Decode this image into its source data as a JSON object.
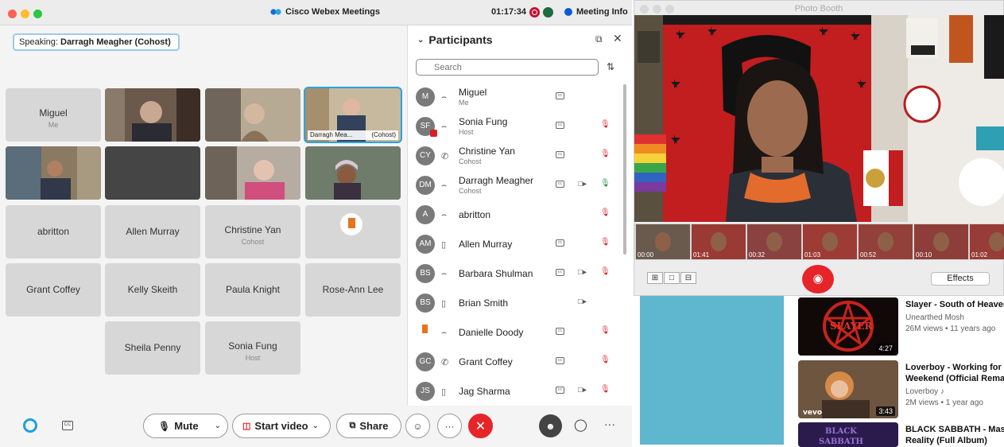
{
  "webex": {
    "app_title": "Cisco Webex Meetings",
    "clock": "01:17:34",
    "meeting_info": "Meeting Info",
    "speaking_prefix": "Speaking:",
    "speaking_name": "Darragh Meagher (Cohost)",
    "grid": [
      {
        "name": "Miguel",
        "sub": "Me",
        "kind": "name"
      },
      {
        "name": "",
        "sub": "",
        "kind": "video"
      },
      {
        "name": "",
        "sub": "",
        "kind": "video"
      },
      {
        "name": "Darragh Mea...",
        "sub": "(Cohost)",
        "kind": "video-selected"
      },
      {
        "name": "",
        "sub": "",
        "kind": "video"
      },
      {
        "name": "",
        "sub": "",
        "kind": "dark"
      },
      {
        "name": "",
        "sub": "",
        "kind": "video"
      },
      {
        "name": "",
        "sub": "",
        "kind": "video"
      },
      {
        "name": "abritton",
        "sub": "",
        "kind": "name"
      },
      {
        "name": "Allen Murray",
        "sub": "",
        "kind": "name"
      },
      {
        "name": "Christine Yan",
        "sub": "Cohost",
        "kind": "name"
      },
      {
        "name": "",
        "sub": "",
        "kind": "logo"
      },
      {
        "name": "Grant Coffey",
        "sub": "",
        "kind": "name"
      },
      {
        "name": "Kelly Skeith",
        "sub": "",
        "kind": "name"
      },
      {
        "name": "Paula Knight",
        "sub": "",
        "kind": "name"
      },
      {
        "name": "Rose-Ann Lee",
        "sub": "",
        "kind": "name"
      },
      {
        "name": "Sheila Penny",
        "sub": "",
        "kind": "name"
      },
      {
        "name": "Sonia Fung",
        "sub": "Host",
        "kind": "name"
      }
    ],
    "panel": {
      "title": "Participants",
      "search_placeholder": "Search",
      "participants": [
        {
          "initials": "M",
          "name": "Miguel",
          "role": "Me",
          "device": "headset",
          "cc": true,
          "video": false,
          "mic": "none"
        },
        {
          "initials": "SF",
          "name": "Sonia Fung",
          "role": "Host",
          "device": "headset",
          "cc": true,
          "video": false,
          "mic": "muted"
        },
        {
          "initials": "CY",
          "name": "Christine Yan",
          "role": "Cohost",
          "device": "phone",
          "cc": true,
          "video": false,
          "mic": "muted"
        },
        {
          "initials": "DM",
          "name": "Darragh Meagher",
          "role": "Cohost",
          "device": "headset",
          "cc": true,
          "video": true,
          "mic": "on"
        },
        {
          "initials": "A",
          "name": "abritton",
          "role": "",
          "device": "headset",
          "cc": false,
          "video": false,
          "mic": "muted"
        },
        {
          "initials": "AM",
          "name": "Allen Murray",
          "role": "",
          "device": "mobile",
          "cc": true,
          "video": false,
          "mic": "muted"
        },
        {
          "initials": "BS",
          "name": "Barbara Shulman",
          "role": "",
          "device": "headset",
          "cc": true,
          "video": true,
          "mic": "muted"
        },
        {
          "initials": "BS",
          "name": "Brian Smith",
          "role": "",
          "device": "mobile",
          "cc": false,
          "video": true,
          "mic": "none"
        },
        {
          "initials": "",
          "name": "Danielle Doody",
          "role": "",
          "device": "headset",
          "cc": true,
          "video": false,
          "mic": "muted",
          "logo": true
        },
        {
          "initials": "GC",
          "name": "Grant Coffey",
          "role": "",
          "device": "phone",
          "cc": true,
          "video": false,
          "mic": "muted"
        },
        {
          "initials": "JS",
          "name": "Jag Sharma",
          "role": "",
          "device": "mobile",
          "cc": true,
          "video": true,
          "mic": "muted"
        }
      ]
    },
    "toolbar": {
      "mute": "Mute",
      "start_video": "Start video",
      "share": "Share"
    }
  },
  "photobooth": {
    "title": "Photo Booth",
    "thumb_labels": [
      "00:00",
      "01:41",
      "00:32",
      "01:03",
      "00:52",
      "00:10",
      "01:02"
    ],
    "effects": "Effects"
  },
  "youtube": {
    "videos": [
      {
        "title_line1": "Slayer - South of Heaven",
        "title_line2": "",
        "channel": "Unearthed Mosh",
        "meta": "26M views • 11 years ago",
        "duration": "4:27"
      },
      {
        "title_line1": "Loverboy - Working for the",
        "title_line2": "Weekend (Official Remaster)",
        "channel": "Loverboy",
        "meta": "2M views • 1 year ago",
        "duration": "3:43",
        "thumb_logo": "vevo"
      },
      {
        "title_line1": "BLACK SABBATH - Master of",
        "title_line2": "Reality (Full Album)",
        "channel": "",
        "meta": "",
        "duration": "",
        "thumb_text": "BLACK SABBATH"
      }
    ]
  },
  "colors": {
    "accent_blue": "#2ba3e0",
    "end_red": "#e5252a",
    "muted_red": "#d81f26",
    "active_green": "#1b8b3c"
  }
}
